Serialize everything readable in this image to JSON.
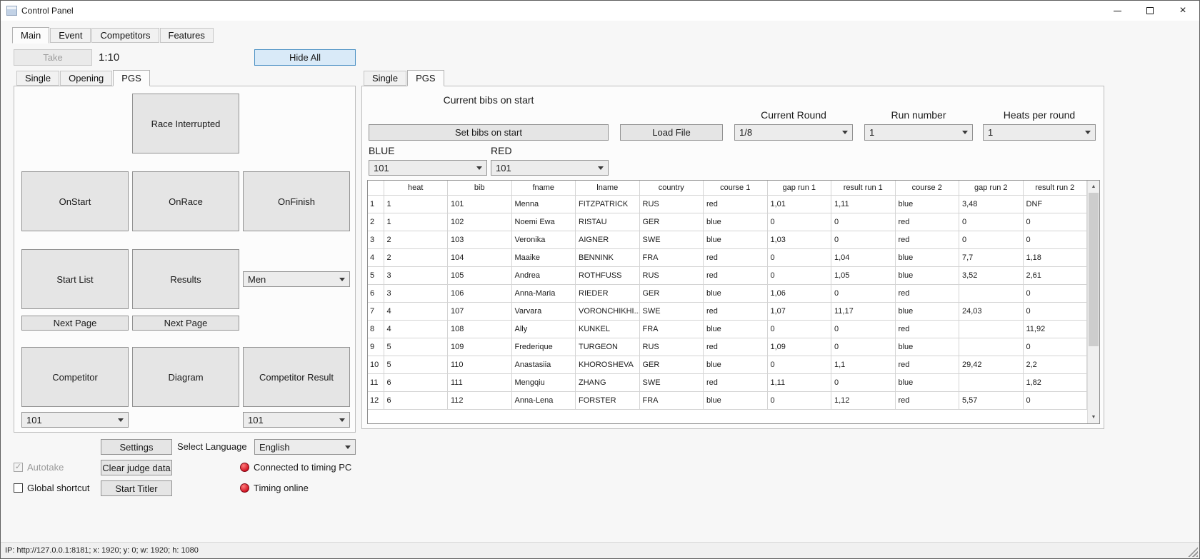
{
  "window": {
    "title": "Control Panel",
    "status_text": "IP: http://127.0.0.1:8181; x: 1920; y: 0; w: 1920; h: 1080"
  },
  "main_tabs": {
    "items": [
      "Main",
      "Event",
      "Competitors",
      "Features"
    ],
    "selected": "Main"
  },
  "toolbar": {
    "take": "Take",
    "time": "1:10",
    "hide_all": "Hide All"
  },
  "left_panel": {
    "tabs": {
      "items": [
        "Single",
        "Opening",
        "PGS"
      ],
      "selected": "PGS"
    },
    "buttons": {
      "race_interrupted": "Race Interrupted",
      "onstart": "OnStart",
      "onrace": "OnRace",
      "onfinish": "OnFinish",
      "start_list": "Start List",
      "results": "Results",
      "next_page_left": "Next Page",
      "next_page_right": "Next Page",
      "competitor": "Competitor",
      "diagram": "Diagram",
      "competitor_result": "Competitor Result"
    },
    "dropdowns": {
      "gender": "Men",
      "competitor_bib": "101",
      "competitor_result_bib": "101"
    }
  },
  "footer_controls": {
    "settings": "Settings",
    "select_language_label": "Select Language",
    "language": "English",
    "autotake_label": "Autotake",
    "autotake_checked": true,
    "clear_judge_data": "Clear judge data",
    "connected_status": "Connected to timing PC",
    "global_shortcut_label": "Global shortcut",
    "global_shortcut_checked": false,
    "start_titler": "Start Titler",
    "timing_status": "Timing online"
  },
  "right_panel": {
    "tabs": {
      "items": [
        "Single",
        "PGS"
      ],
      "selected": "PGS"
    },
    "title": "Current bibs on start",
    "buttons": {
      "set_bibs": "Set bibs on start",
      "load_file": "Load File"
    },
    "current_round": {
      "label": "Current Round",
      "value": "1/8"
    },
    "run_number": {
      "label": "Run number",
      "value": "1"
    },
    "heats_per_round": {
      "label": "Heats per round",
      "value": "1"
    },
    "blue": {
      "label": "BLUE",
      "value": "101"
    },
    "red": {
      "label": "RED",
      "value": "101"
    },
    "table": {
      "headers": [
        "",
        "heat",
        "bib",
        "fname",
        "lname",
        "country",
        "course 1",
        "gap run 1",
        "result run 1",
        "course 2",
        "gap run 2",
        "result run 2"
      ],
      "rows": [
        [
          "1",
          "1",
          "101",
          "Menna",
          "FITZPATRICK",
          "RUS",
          "red",
          "1,01",
          "1,11",
          "blue",
          "3,48",
          "DNF"
        ],
        [
          "2",
          "1",
          "102",
          "Noemi Ewa",
          "RISTAU",
          "GER",
          "blue",
          "0",
          "0",
          "red",
          "0",
          "0"
        ],
        [
          "3",
          "2",
          "103",
          "Veronika",
          "AIGNER",
          "SWE",
          "blue",
          "1,03",
          "0",
          "red",
          "0",
          "0"
        ],
        [
          "4",
          "2",
          "104",
          "Maaike",
          "BENNINK",
          "FRA",
          "red",
          "0",
          "1,04",
          "blue",
          "7,7",
          "1,18"
        ],
        [
          "5",
          "3",
          "105",
          "Andrea",
          "ROTHFUSS",
          "RUS",
          "red",
          "0",
          "1,05",
          "blue",
          "3,52",
          "2,61"
        ],
        [
          "6",
          "3",
          "106",
          "Anna-Maria",
          "RIEDER",
          "GER",
          "blue",
          "1,06",
          "0",
          "red",
          "",
          "0"
        ],
        [
          "7",
          "4",
          "107",
          "Varvara",
          "VORONCHIKHI...",
          "SWE",
          "red",
          "1,07",
          "11,17",
          "blue",
          "24,03",
          "0"
        ],
        [
          "8",
          "4",
          "108",
          "Ally",
          "KUNKEL",
          "FRA",
          "blue",
          "0",
          "0",
          "red",
          "",
          "11,92"
        ],
        [
          "9",
          "5",
          "109",
          "Frederique",
          "TURGEON",
          "RUS",
          "red",
          "1,09",
          "0",
          "blue",
          "",
          "0"
        ],
        [
          "10",
          "5",
          "110",
          "Anastasiia",
          "KHOROSHEVA",
          "GER",
          "blue",
          "0",
          "1,1",
          "red",
          "29,42",
          "2,2"
        ],
        [
          "11",
          "6",
          "111",
          "Mengqiu",
          "ZHANG",
          "SWE",
          "red",
          "1,11",
          "0",
          "blue",
          "",
          "1,82"
        ],
        [
          "12",
          "6",
          "112",
          "Anna-Lena",
          "FORSTER",
          "FRA",
          "blue",
          "0",
          "1,12",
          "red",
          "5,57",
          "0"
        ]
      ]
    }
  },
  "icons": {
    "check": "✓",
    "close": "×",
    "scroll_up": "▲",
    "scroll_down": "▼"
  },
  "colors": {
    "highlight_bg": "#d9eaf8",
    "highlight_border": "#4a90c4",
    "status_red": "#cf1020"
  }
}
